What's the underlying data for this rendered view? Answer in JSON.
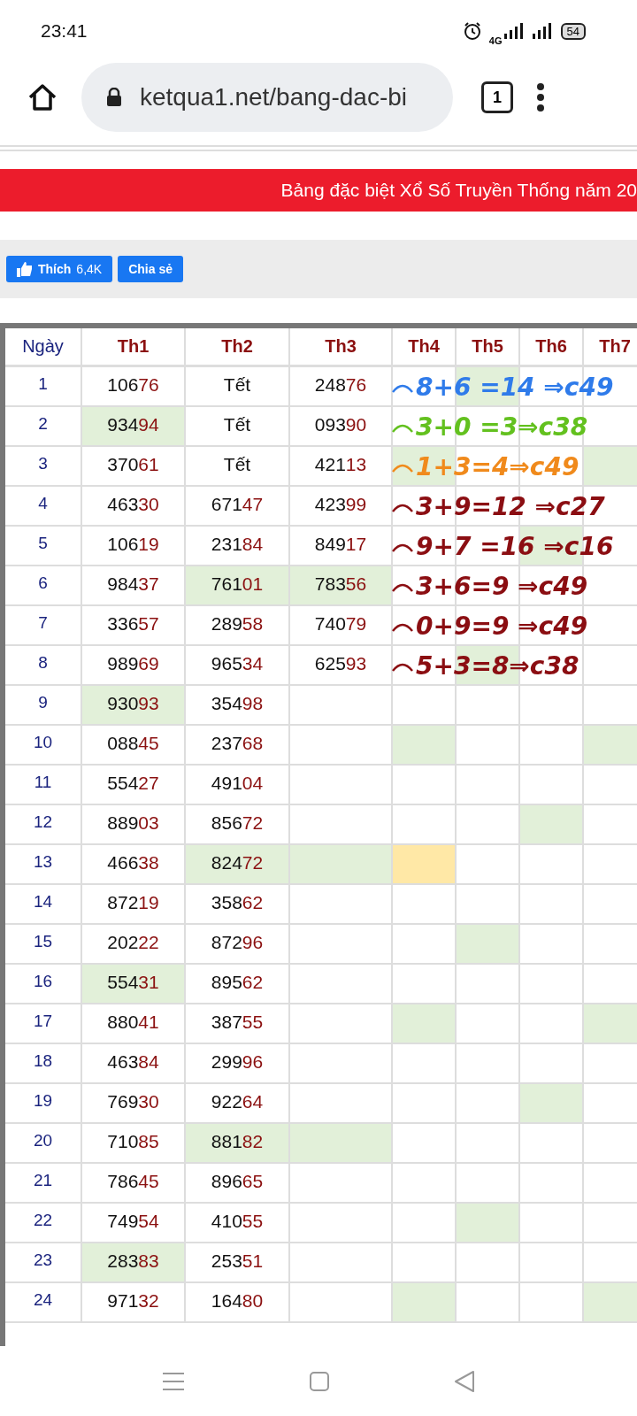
{
  "status_bar": {
    "time": "23:41",
    "network": "4G",
    "battery": "54"
  },
  "browser": {
    "url": "ketqua1.net/bang-dac-bi",
    "tab_count": "1"
  },
  "banner": {
    "title": "Bảng đặc biệt Xổ Số Truyền Thống năm 20"
  },
  "social": {
    "like_label": "Thích",
    "like_count": "6,4K",
    "share_label": "Chia sẻ"
  },
  "table": {
    "columns": [
      "Ngày",
      "Th1",
      "Th2",
      "Th3",
      "Th4",
      "Th5",
      "Th6",
      "Th7"
    ],
    "rows": [
      {
        "cells": [
          {
            "text": "1"
          },
          {
            "text": "10676"
          },
          {
            "text": "Tết"
          },
          {
            "text": "24876"
          },
          {},
          {
            "color": "#e2f0d9"
          },
          {},
          {}
        ]
      },
      {
        "cells": [
          {
            "text": "2"
          },
          {
            "text": "93494",
            "color": "#e2f0d9"
          },
          {
            "text": "Tết"
          },
          {
            "text": "09390"
          },
          {},
          {},
          {},
          {}
        ]
      },
      {
        "cells": [
          {
            "text": "3"
          },
          {
            "text": "37061"
          },
          {
            "text": "Tết"
          },
          {
            "text": "42113"
          },
          {
            "color": "#e2f0d9"
          },
          {},
          {},
          {
            "color": "#e2f0d9"
          }
        ]
      },
      {
        "cells": [
          {
            "text": "4"
          },
          {
            "text": "46330"
          },
          {
            "text": "67147"
          },
          {
            "text": "42399"
          },
          {},
          {},
          {},
          {}
        ]
      },
      {
        "cells": [
          {
            "text": "5"
          },
          {
            "text": "10619"
          },
          {
            "text": "23184"
          },
          {
            "text": "84917"
          },
          {},
          {},
          {
            "color": "#e2f0d9"
          },
          {}
        ]
      },
      {
        "cells": [
          {
            "text": "6"
          },
          {
            "text": "98437"
          },
          {
            "text": "76101",
            "color": "#e2f0d9"
          },
          {
            "text": "78356",
            "color": "#e2f0d9"
          },
          {},
          {},
          {},
          {}
        ]
      },
      {
        "cells": [
          {
            "text": "7"
          },
          {
            "text": "33657"
          },
          {
            "text": "28958"
          },
          {
            "text": "74079"
          },
          {},
          {},
          {},
          {}
        ]
      },
      {
        "cells": [
          {
            "text": "8"
          },
          {
            "text": "98969"
          },
          {
            "text": "96534"
          },
          {
            "text": "62593"
          },
          {},
          {
            "color": "#e2f0d9"
          },
          {},
          {}
        ]
      },
      {
        "cells": [
          {
            "text": "9"
          },
          {
            "text": "93093",
            "color": "#e2f0d9"
          },
          {
            "text": "35498"
          },
          {},
          {},
          {},
          {},
          {}
        ]
      },
      {
        "cells": [
          {
            "text": "10"
          },
          {
            "text": "08845"
          },
          {
            "text": "23768"
          },
          {},
          {
            "color": "#e2f0d9"
          },
          {},
          {},
          {
            "color": "#e2f0d9"
          }
        ]
      },
      {
        "cells": [
          {
            "text": "11"
          },
          {
            "text": "55427"
          },
          {
            "text": "49104"
          },
          {},
          {},
          {},
          {},
          {}
        ]
      },
      {
        "cells": [
          {
            "text": "12"
          },
          {
            "text": "88903"
          },
          {
            "text": "85672"
          },
          {},
          {},
          {},
          {
            "color": "#e2f0d9"
          },
          {}
        ]
      },
      {
        "cells": [
          {
            "text": "13"
          },
          {
            "text": "46638"
          },
          {
            "text": "82472",
            "color": "#e2f0d9"
          },
          {
            "color": "#e2f0d9"
          },
          {
            "color": "#ffe8a6"
          },
          {},
          {},
          {}
        ]
      },
      {
        "cells": [
          {
            "text": "14"
          },
          {
            "text": "87219"
          },
          {
            "text": "35862"
          },
          {},
          {},
          {},
          {},
          {}
        ]
      },
      {
        "cells": [
          {
            "text": "15"
          },
          {
            "text": "20222"
          },
          {
            "text": "87296"
          },
          {},
          {},
          {
            "color": "#e2f0d9"
          },
          {},
          {}
        ]
      },
      {
        "cells": [
          {
            "text": "16"
          },
          {
            "text": "55431",
            "color": "#e2f0d9"
          },
          {
            "text": "89562"
          },
          {},
          {},
          {},
          {},
          {}
        ]
      },
      {
        "cells": [
          {
            "text": "17"
          },
          {
            "text": "88041"
          },
          {
            "text": "38755"
          },
          {},
          {
            "color": "#e2f0d9"
          },
          {},
          {},
          {
            "color": "#e2f0d9"
          }
        ]
      },
      {
        "cells": [
          {
            "text": "18"
          },
          {
            "text": "46384"
          },
          {
            "text": "29996"
          },
          {},
          {},
          {},
          {},
          {}
        ]
      },
      {
        "cells": [
          {
            "text": "19"
          },
          {
            "text": "76930"
          },
          {
            "text": "92264"
          },
          {},
          {},
          {},
          {
            "color": "#e2f0d9"
          },
          {}
        ]
      },
      {
        "cells": [
          {
            "text": "20"
          },
          {
            "text": "71085"
          },
          {
            "text": "88182",
            "color": "#e2f0d9"
          },
          {
            "color": "#e2f0d9"
          },
          {},
          {},
          {},
          {}
        ]
      },
      {
        "cells": [
          {
            "text": "21"
          },
          {
            "text": "78645"
          },
          {
            "text": "89665"
          },
          {},
          {},
          {},
          {},
          {}
        ]
      },
      {
        "cells": [
          {
            "text": "22"
          },
          {
            "text": "74954"
          },
          {
            "text": "41055"
          },
          {},
          {},
          {
            "color": "#e2f0d9"
          },
          {},
          {}
        ]
      },
      {
        "cells": [
          {
            "text": "23"
          },
          {
            "text": "28383",
            "color": "#e2f0d9"
          },
          {
            "text": "25351"
          },
          {},
          {},
          {},
          {},
          {}
        ]
      },
      {
        "cells": [
          {
            "text": "24"
          },
          {
            "text": "97132"
          },
          {
            "text": "16480"
          },
          {},
          {
            "color": "#e2f0d9"
          },
          {},
          {},
          {
            "color": "#e2f0d9"
          }
        ]
      }
    ]
  },
  "annotations": [
    {
      "text": "8+6 =14 ⇒c49",
      "color": "#2f7bea"
    },
    {
      "text": "3+0 =3⇒c38",
      "color": "#63c11f"
    },
    {
      "text": "1+3=4⇒c49",
      "color": "#f08a1c"
    },
    {
      "text": "3+9=12 ⇒c27",
      "color": "#8b0e12"
    },
    {
      "text": "9+7 =16 ⇒c16",
      "color": "#8b0e12"
    },
    {
      "text": "3+6=9 ⇒c49",
      "color": "#8b0e12"
    },
    {
      "text": "0+9=9 ⇒c49",
      "color": "#8b0e12"
    },
    {
      "text": "5+3=8⇒c38",
      "color": "#8b0e12"
    }
  ]
}
